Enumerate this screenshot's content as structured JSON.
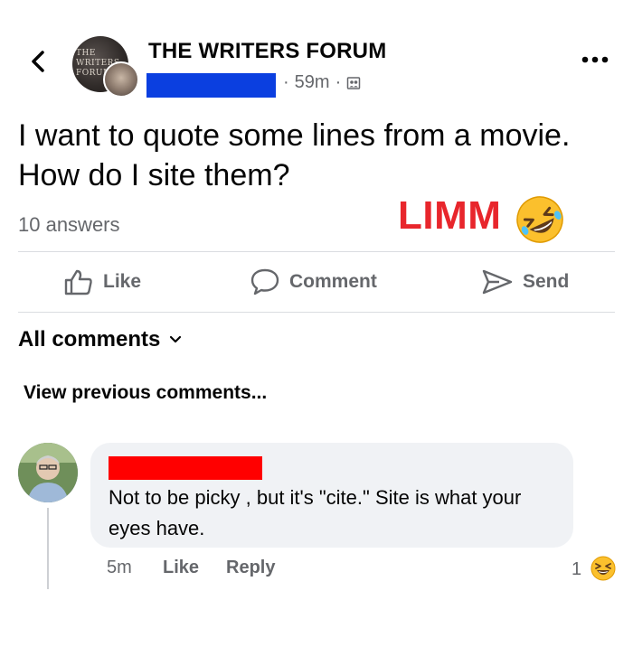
{
  "header": {
    "back_icon": "chevron-left-icon",
    "group_avatar_text": "THE WRITERS FORUM",
    "group_name": "THE WRITERS FORUM",
    "time": "59m",
    "separator": "·",
    "privacy_icon": "group-members-icon",
    "more_icon": "ellipsis-icon"
  },
  "post": {
    "question": "I want to quote some lines from a movie. How do I site them?",
    "answers": "10 answers",
    "overlay_text": "LIMM",
    "overlay_emoji": "rolling-on-floor-laughing-icon"
  },
  "actions": {
    "like": "Like",
    "comment": "Comment",
    "send": "Send"
  },
  "comments": {
    "filter_label": "All comments",
    "view_previous": "View previous comments...",
    "items": [
      {
        "text": "Not to be picky , but it's \"cite.\" Site is what your eyes have.",
        "time": "5m",
        "like": "Like",
        "reply": "Reply",
        "reaction_count": "1",
        "reaction_icon": "laughing-emoji-icon"
      }
    ]
  },
  "colors": {
    "redaction_blue": "#0b3fe0",
    "redaction_red": "#ff0000",
    "overlay_red": "#e8262c",
    "secondary_text": "#65676b",
    "bubble_bg": "#f0f2f5"
  }
}
